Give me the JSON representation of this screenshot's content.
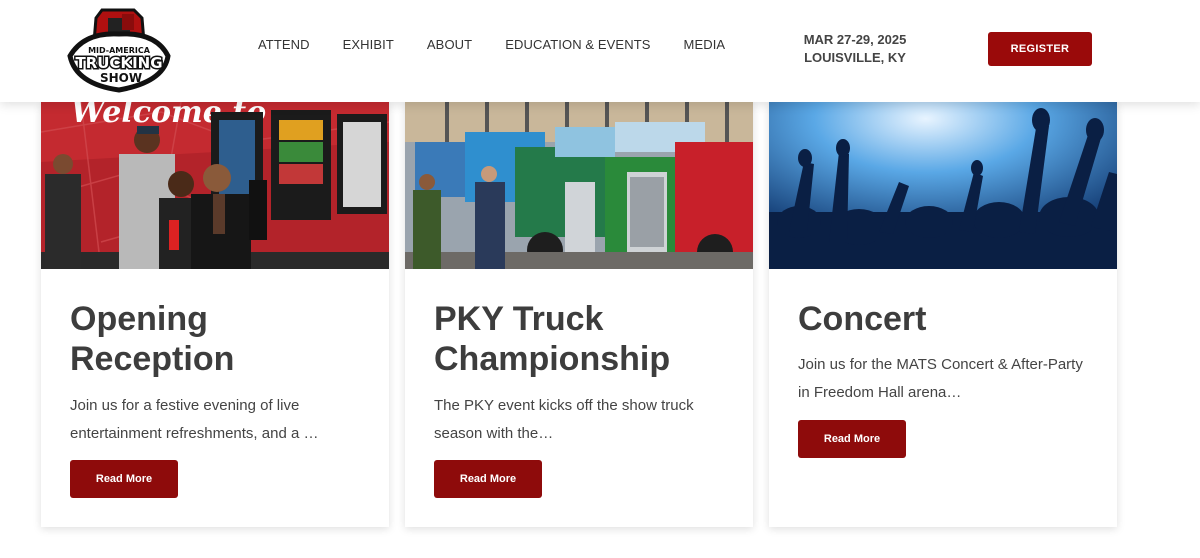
{
  "header": {
    "logo": {
      "line1": "MID-AMERICA",
      "line2": "TRUCKING",
      "line3": "SHOW"
    },
    "nav": [
      "ATTEND",
      "EXHIBIT",
      "ABOUT",
      "EDUCATION & EVENTS",
      "MEDIA"
    ],
    "date": "MAR 27-29, 2025",
    "location": "LOUISVILLE, KY",
    "register_label": "REGISTER"
  },
  "cards": [
    {
      "title_line1": "Opening",
      "title_line2": "Reception",
      "text": "Join us for a festive evening of live entertainment refreshments, and a …",
      "button": "Read More",
      "image_text": "Welcome to"
    },
    {
      "title_line1": "PKY Truck",
      "title_line2": "Championship",
      "text": "The PKY event kicks off the show truck season with the…",
      "button": "Read More"
    },
    {
      "title_line1": "Concert",
      "title_line2": "",
      "text": "Join us for the MATS Concert & After-Party in Freedom Hall arena…",
      "button": "Read More"
    }
  ],
  "colors": {
    "brand_red": "#9a0a0a",
    "text_dark": "#3d3d3d"
  }
}
